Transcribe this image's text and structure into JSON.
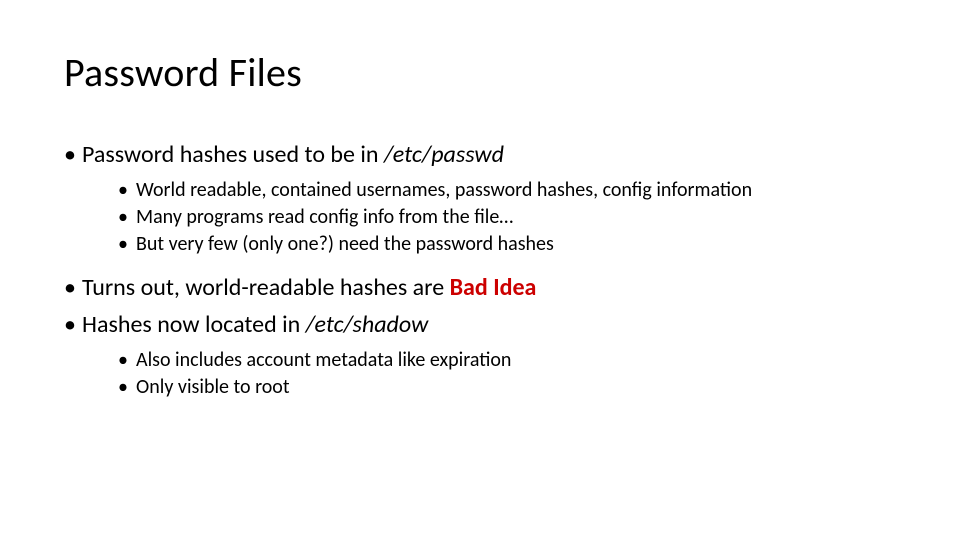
{
  "title": "Password Files",
  "bullets": {
    "b1": {
      "pre": "Password hashes used to be in ",
      "path": "/etc/passwd",
      "sub": [
        "World readable, contained usernames, password hashes, config information",
        "Many programs read config info from the file…",
        "But very few (only one?) need the password hashes"
      ]
    },
    "b2": {
      "pre": "Turns out, world-readable hashes are ",
      "bad": "Bad Idea"
    },
    "b3": {
      "pre": "Hashes now located in ",
      "path": "/etc/shadow",
      "sub": [
        "Also includes account metadata like expiration",
        "Only visible to root"
      ]
    }
  }
}
